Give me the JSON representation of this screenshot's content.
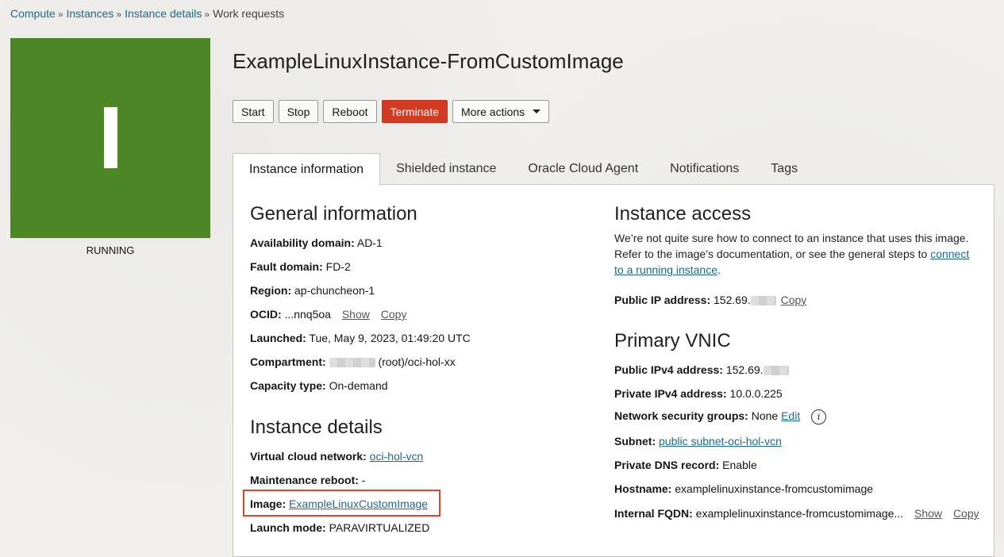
{
  "breadcrumb": {
    "items": [
      "Compute",
      "Instances",
      "Instance details"
    ],
    "current": "Work requests",
    "separator": "»"
  },
  "instance": {
    "letter": "I",
    "state": "RUNNING",
    "tile_color": "#4e8626",
    "title": "ExampleLinuxInstance-FromCustomImage"
  },
  "actions": {
    "start": "Start",
    "stop": "Stop",
    "reboot": "Reboot",
    "terminate": "Terminate",
    "more": "More actions"
  },
  "tabs": [
    "Instance information",
    "Shielded instance",
    "Oracle Cloud Agent",
    "Notifications",
    "Tags"
  ],
  "general": {
    "heading": "General information",
    "availability_domain": {
      "label": "Availability domain:",
      "value": "AD-1"
    },
    "fault_domain": {
      "label": "Fault domain:",
      "value": "FD-2"
    },
    "region": {
      "label": "Region:",
      "value": "ap-chuncheon-1"
    },
    "ocid": {
      "label": "OCID:",
      "value": "...nnq5oa",
      "show": "Show",
      "copy": "Copy"
    },
    "launched": {
      "label": "Launched:",
      "value": "Tue, May 9, 2023, 01:49:20 UTC"
    },
    "compartment": {
      "label": "Compartment:",
      "value": "(root)/oci-hol-xx"
    },
    "capacity_type": {
      "label": "Capacity type:",
      "value": "On-demand"
    }
  },
  "details": {
    "heading": "Instance details",
    "vcn": {
      "label": "Virtual cloud network:",
      "value": "oci-hol-vcn"
    },
    "maintenance_reboot": {
      "label": "Maintenance reboot:",
      "value": "-"
    },
    "image": {
      "label": "Image:",
      "value": "ExampleLinuxCustomImage"
    },
    "launch_mode": {
      "label": "Launch mode:",
      "value": "PARAVIRTUALIZED"
    }
  },
  "access": {
    "heading": "Instance access",
    "text_1": "We’re not quite sure how to connect to an instance that uses this image.",
    "text_2": "Refer to the image’s documentation, or see the general steps to",
    "link_1": "connect",
    "link_2": "to a running instance",
    "period": ".",
    "public_ip": {
      "label": "Public IP address:",
      "value": "152.69.",
      "copy": "Copy"
    }
  },
  "vnic": {
    "heading": "Primary VNIC",
    "public_ipv4": {
      "label": "Public IPv4 address:",
      "value": "152.69."
    },
    "private_ipv4": {
      "label": "Private IPv4 address:",
      "value": "10.0.0.225"
    },
    "nsg": {
      "label": "Network security groups:",
      "value": "None",
      "edit": "Edit"
    },
    "subnet": {
      "label": "Subnet:",
      "value": "public subnet-oci-hol-vcn"
    },
    "private_dns": {
      "label": "Private DNS record:",
      "value": "Enable"
    },
    "hostname": {
      "label": "Hostname:",
      "value": "examplelinuxinstance-fromcustomimage"
    },
    "fqdn": {
      "label": "Internal FQDN:",
      "value": "examplelinuxinstance-fromcustomimage...",
      "show": "Show",
      "copy": "Copy"
    }
  },
  "colors": {
    "accent_link": "#1a6a8d",
    "danger": "#d33a22",
    "highlight_border": "#e0442a"
  }
}
